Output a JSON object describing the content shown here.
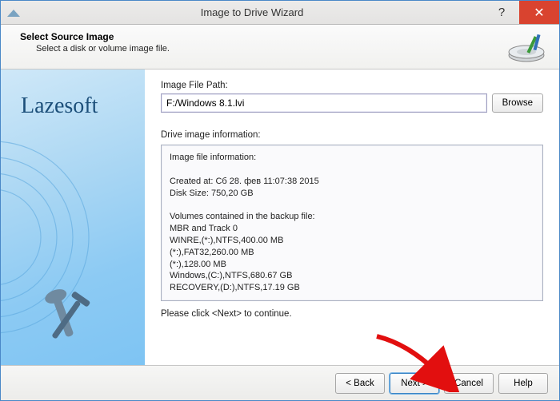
{
  "window": {
    "title": "Image to Drive Wizard",
    "help_glyph": "?",
    "close_glyph": "✕"
  },
  "header": {
    "title": "Select Source Image",
    "subtitle": "Select a disk or volume image file."
  },
  "sidebar": {
    "brand": "Lazesoft"
  },
  "main": {
    "path_label": "Image File Path:",
    "path_value": "F:/Windows 8.1.lvi",
    "browse_label": "Browse",
    "info_label": "Drive image information:",
    "info_text": "Image file information:\n\nCreated at: Сб 28. фев 11:07:38 2015\nDisk Size: 750,20 GB\n\nVolumes contained in the backup file:\nMBR and Track 0\nWINRE,(*:),NTFS,400.00 MB\n(*:),FAT32,260.00 MB\n(*:),128.00 MB\nWindows,(C:),NTFS,680.67 GB\nRECOVERY,(D:),NTFS,17.19 GB",
    "hint": "Please click <Next> to continue."
  },
  "footer": {
    "back_label": "< Back",
    "next_label": "Next >",
    "cancel_label": "Cancel",
    "help_label": "Help"
  }
}
